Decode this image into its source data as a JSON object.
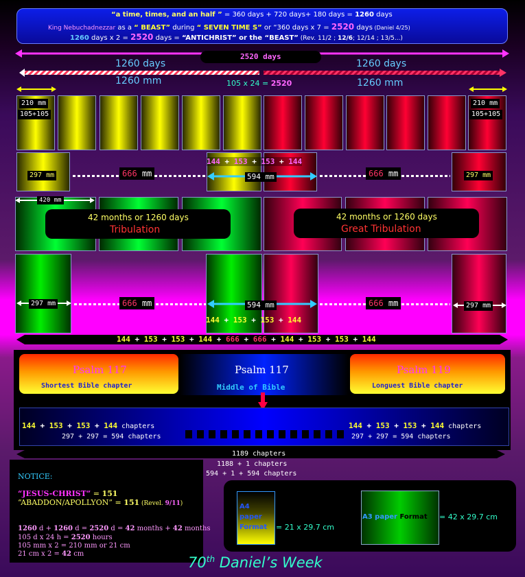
{
  "header": {
    "line1_quote": "“a time, times, and an half ”",
    "line1_rest": " = 360 days + 720 days+ 180 days = ",
    "line1_val": "1260",
    "line1_unit": " days",
    "line2_king": "King Nebuchadnezzar",
    "line2_as": " as a ",
    "line2_beast": "“ BEAST”",
    "line2_during": " during ",
    "line2_seven": "“ SEVEN TIME S”",
    "line2_or": " or “360 days  x 7 = ",
    "line2_val": "2520",
    "line2_unit": " days",
    "line2_ref": " (Daniel 4/25)",
    "line3_val1": "1260",
    "line3_mid": " days x 2 = ",
    "line3_val2": "2520",
    "line3_days": " days = ",
    "line3_anti": "“ANTICHRIST” or the “BEAST”",
    "line3_ref1": " (Rev. 11/2 ; ",
    "line3_ref2": "12/6",
    "line3_ref3": "; 12/14 ; 13/5...)"
  },
  "spans": {
    "total": "2520  days",
    "left_days_num": "1260",
    "left_days_unit": " days",
    "right_days_num": "1260",
    "right_days_unit": " days",
    "left_mm_num": "1260",
    "left_mm_unit": " mm",
    "right_mm_num": "1260",
    "right_mm_unit": " mm",
    "calc_a": "105 x 24 = ",
    "calc_b": "2520"
  },
  "row1": {
    "left_label1": "210  mm",
    "left_label2": "105+105",
    "right_label1": "210  mm",
    "right_label2": "105+105"
  },
  "row2": {
    "left_297": "297  mm",
    "left_666a": "666",
    "left_666b": " mm",
    "center_top_a": "144",
    "center_top_b": " + ",
    "center_top_c": "153",
    "center_top_d": " + ",
    "center_top_e": "153",
    "center_top_f": " + ",
    "center_top_g": "144",
    "center_594": "594  mm",
    "right_666a": "666",
    "right_666b": " mm",
    "right_297": "297  mm"
  },
  "row3": {
    "left_420": "420  mm",
    "left_pill_top": "42 months or 1260 days",
    "left_pill_bottom": "Tribulation",
    "right_pill_top": "42 months or 1260 days",
    "right_pill_bottom": "Great Tribulation"
  },
  "row4": {
    "left_297": "297  mm",
    "left_666a": "666",
    "left_666b": " mm",
    "center_594": "594  mm",
    "right_666a": "666",
    "right_666b": " mm",
    "right_297": "297  mm",
    "center_bottom_a": "144",
    "center_bottom_b": " + ",
    "center_bottom_c": "153",
    "center_bottom_d": " + ",
    "center_bottom_e": "153",
    "center_bottom_f": " + ",
    "center_bottom_g": "144"
  },
  "sum_bar": {
    "a": "144",
    "b": " + ",
    "c": "153",
    "d": " + ",
    "e": "153",
    "f": " + ",
    "g": "144",
    "h": " + ",
    "i": "666",
    "j": " + ",
    "k": "666",
    "l": " + ",
    "m": "144",
    "n": " + ",
    "o": "153",
    "p": " + ",
    "q": "153",
    "r": " + ",
    "s": "144"
  },
  "psalms": {
    "left_title": "Psalm 117",
    "left_sub": "Shortest Bible chapter",
    "mid_title": "Psalm 117",
    "mid_sub": "Middle of Bible",
    "right_title": "Psalm 119",
    "right_sub": "Longuest Bible chapter"
  },
  "chapters": {
    "left_a": "144",
    "left_b": " + ",
    "left_c": "153",
    "left_d": " + ",
    "left_e": "153",
    "left_f": " + ",
    "left_g": "144",
    "left_h": " chapters",
    "left_sum": "297 + 297 = 594 chapters",
    "right_a": "144",
    "right_b": " + ",
    "right_c": "153",
    "right_d": " + ",
    "right_e": "153",
    "right_f": " + ",
    "right_g": "144",
    "right_h": " chapters",
    "right_sum": "297 + 297 = 594 chapters",
    "total": "1189  chapters",
    "total2": "1188 + 1  chapters",
    "total3": "594 + 1 + 594 chapters"
  },
  "notice": {
    "title": "NOTICE:",
    "jc_a": "“JESUS-CHRIST”",
    "jc_b": " = ",
    "jc_c": "151",
    "ab_a": "“ABADDON/APOLLYON”",
    "ab_b": " = ",
    "ab_c": "151",
    "ab_d": " (Revel. ",
    "ab_e": "9/11",
    "ab_f": ")",
    "c1_a": "1260",
    "c1_b": " d + ",
    "c1_c": "1260",
    "c1_d": " d = ",
    "c1_e": "2520",
    "c1_f": " d = ",
    "c1_g": "42",
    "c1_h": " months + ",
    "c1_i": " 42",
    "c1_j": "  months",
    "c2_a": "105 d x 24 h = ",
    "c2_b": "2520",
    "c2_c": " hours",
    "c3": "105 mm x 2 = 210 mm or 21 cm",
    "c4_a": "21 cm x 2 = ",
    "c4_b": "42",
    "c4_c": " cm"
  },
  "formats": {
    "a4_l1": "A4",
    "a4_l2": "paper",
    "a4_l3": "Format",
    "a4_dim": " =  21 x 29.7 cm",
    "a3_l1": "A3 paper",
    "a3_l2": "Format",
    "a3_dim": " =  42 x 29.7 cm"
  },
  "footer": {
    "num": "70",
    "sup": "th",
    "rest": " Daniel’s Week"
  }
}
